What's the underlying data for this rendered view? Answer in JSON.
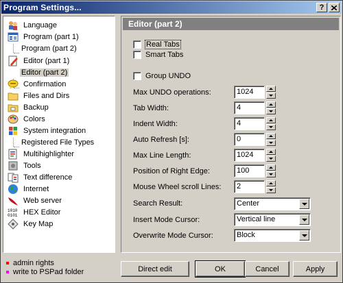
{
  "window": {
    "title": "Program Settings...",
    "help_label": "?",
    "close_label": "X"
  },
  "tree": {
    "items": [
      {
        "label": "Language",
        "icon": "language-icon"
      },
      {
        "label": "Program  (part 1)",
        "icon": "program-icon"
      },
      {
        "label": "Program  (part 2)",
        "icon": null
      },
      {
        "label": "Editor  (part 1)",
        "icon": "editor-icon"
      },
      {
        "label": "Editor  (part 2)",
        "icon": null,
        "selected": true
      },
      {
        "label": "Confirmation",
        "icon": "confirmation-icon"
      },
      {
        "label": "Files and Dirs",
        "icon": "folder-icon"
      },
      {
        "label": "Backup",
        "icon": "backup-icon"
      },
      {
        "label": "Colors",
        "icon": "colors-icon"
      },
      {
        "label": "System integration",
        "icon": "windows-icon"
      },
      {
        "label": "Registered File Types",
        "icon": null
      },
      {
        "label": "Multihighlighter",
        "icon": "highlighter-icon"
      },
      {
        "label": "Tools",
        "icon": "tools-icon"
      },
      {
        "label": "Text difference",
        "icon": "diff-icon"
      },
      {
        "label": "Internet",
        "icon": "globe-icon"
      },
      {
        "label": "Web server",
        "icon": "feather-icon"
      },
      {
        "label": "HEX Editor",
        "icon": "hex-icon"
      },
      {
        "label": "Key Map",
        "icon": "keymap-icon"
      }
    ]
  },
  "legend": {
    "admin": {
      "label": "admin rights",
      "color": "#ff0000"
    },
    "pspad": {
      "label": "write to PSPad folder",
      "color": "#ff00ff"
    }
  },
  "panel": {
    "header": "Editor  (part 2)",
    "real_tabs": {
      "label": "Real Tabs",
      "checked": false
    },
    "smart_tabs": {
      "label": "Smart Tabs",
      "checked": false
    },
    "group_undo": {
      "label": "Group UNDO",
      "checked": false
    },
    "max_undo": {
      "label": "Max UNDO operations:",
      "value": "1024"
    },
    "tab_width": {
      "label": "Tab Width:",
      "value": "4"
    },
    "indent_width": {
      "label": "Indent Width:",
      "value": "4"
    },
    "auto_refresh": {
      "label": "Auto Refresh [s]:",
      "value": "0"
    },
    "max_line_length": {
      "label": "Max Line Length:",
      "value": "1024"
    },
    "right_edge": {
      "label": "Position of Right Edge:",
      "value": "100"
    },
    "wheel_lines": {
      "label": "Mouse Wheel scroll Lines:",
      "value": "2"
    },
    "search_result": {
      "label": "Search Result:",
      "value": "Center"
    },
    "insert_cursor": {
      "label": "Insert Mode Cursor:",
      "value": "Vertical line"
    },
    "overwrite_cursor": {
      "label": "Overwrite Mode Cursor:",
      "value": "Block"
    }
  },
  "buttons": {
    "direct_edit": "Direct edit",
    "ok": "OK",
    "cancel": "Cancel",
    "apply": "Apply"
  }
}
